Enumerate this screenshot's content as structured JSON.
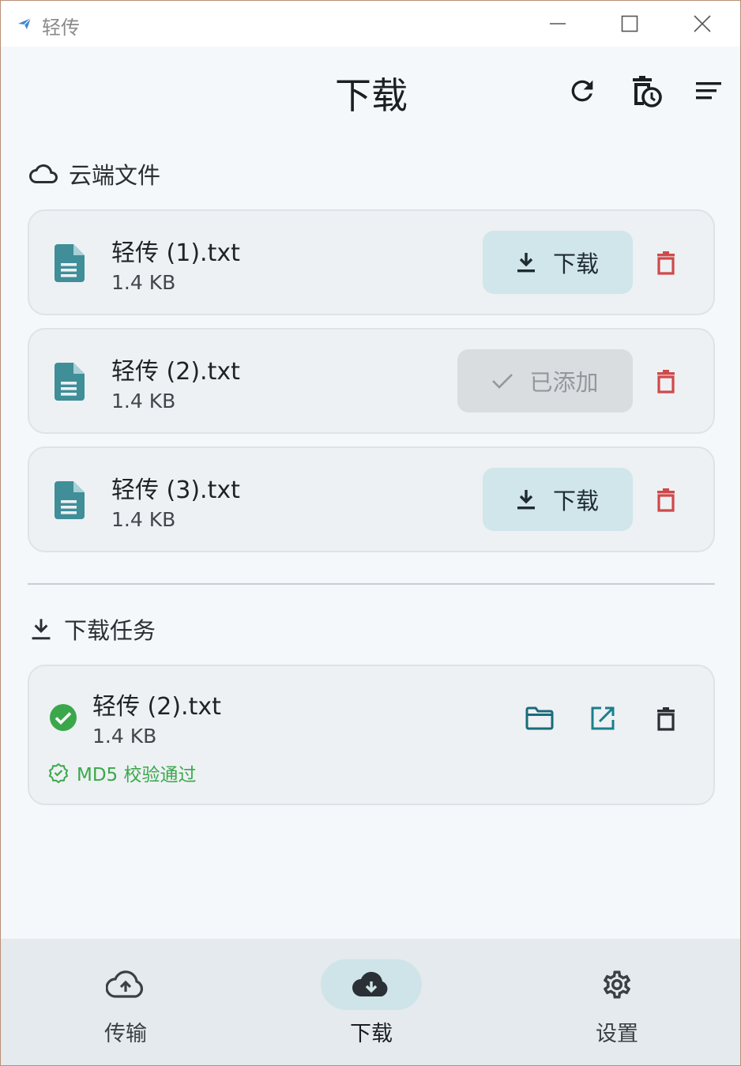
{
  "window": {
    "title": "轻传",
    "controls": [
      "minimize-icon",
      "maximize-icon",
      "close-icon"
    ]
  },
  "header": {
    "title": "下载",
    "actions": [
      "refresh-icon",
      "history-icon",
      "sort-icon"
    ]
  },
  "cloud_section": {
    "title": "云端文件",
    "icon": "cloud-icon",
    "files": [
      {
        "name": "轻传 (1).txt",
        "size": "1.4 KB",
        "action": "下载",
        "state": "download"
      },
      {
        "name": "轻传 (2).txt",
        "size": "1.4 KB",
        "action": "已添加",
        "state": "added"
      },
      {
        "name": "轻传 (3).txt",
        "size": "1.4 KB",
        "action": "下载",
        "state": "download"
      }
    ]
  },
  "tasks_section": {
    "title": "下载任务",
    "icon": "download-icon",
    "tasks": [
      {
        "name": "轻传 (2).txt",
        "size": "1.4 KB",
        "status": "completed",
        "verify": "MD5 校验通过"
      }
    ]
  },
  "bottom_nav": {
    "items": [
      {
        "label": "传输",
        "icon": "cloud-upload-icon",
        "active": false
      },
      {
        "label": "下载",
        "icon": "cloud-download-icon",
        "active": true
      },
      {
        "label": "设置",
        "icon": "gear-icon",
        "active": false
      }
    ]
  },
  "colors": {
    "accent": "#3f8e98",
    "delete": "#d0494a",
    "success": "#3aa84a",
    "download_button_bg": "#d1e6ea",
    "added_button_bg": "#d9dde0"
  }
}
